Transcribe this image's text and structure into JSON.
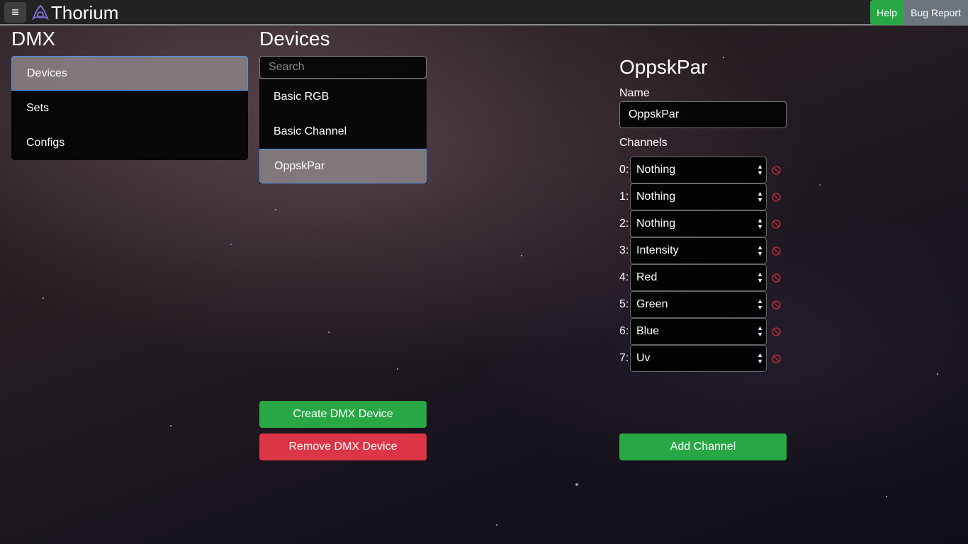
{
  "app": {
    "title": "Thorium",
    "help_label": "Help",
    "bug_label": "Bug Report",
    "menu_glyph": "≡"
  },
  "left": {
    "heading": "DMX",
    "nav": [
      {
        "label": "Devices",
        "active": true
      },
      {
        "label": "Sets",
        "active": false
      },
      {
        "label": "Configs",
        "active": false
      }
    ]
  },
  "devices": {
    "heading": "Devices",
    "search_placeholder": "Search",
    "items": [
      {
        "label": "Basic RGB",
        "active": false
      },
      {
        "label": "Basic Channel",
        "active": false
      },
      {
        "label": "OppskPar",
        "active": true
      }
    ],
    "create_label": "Create DMX Device",
    "remove_label": "Remove DMX Device"
  },
  "detail": {
    "title": "OppskPar",
    "name_label": "Name",
    "name_value": "OppskPar",
    "channels_label": "Channels",
    "channels": [
      {
        "index": "0:",
        "value": "Nothing"
      },
      {
        "index": "1:",
        "value": "Nothing"
      },
      {
        "index": "2:",
        "value": "Nothing"
      },
      {
        "index": "3:",
        "value": "Intensity"
      },
      {
        "index": "4:",
        "value": "Red"
      },
      {
        "index": "5:",
        "value": "Green"
      },
      {
        "index": "6:",
        "value": "Blue"
      },
      {
        "index": "7:",
        "value": "Uv"
      }
    ],
    "add_label": "Add Channel"
  },
  "colors": {
    "green": "#28a745",
    "red": "#dc3545",
    "gray": "#6c757d",
    "accent": "#4a8ef0"
  }
}
